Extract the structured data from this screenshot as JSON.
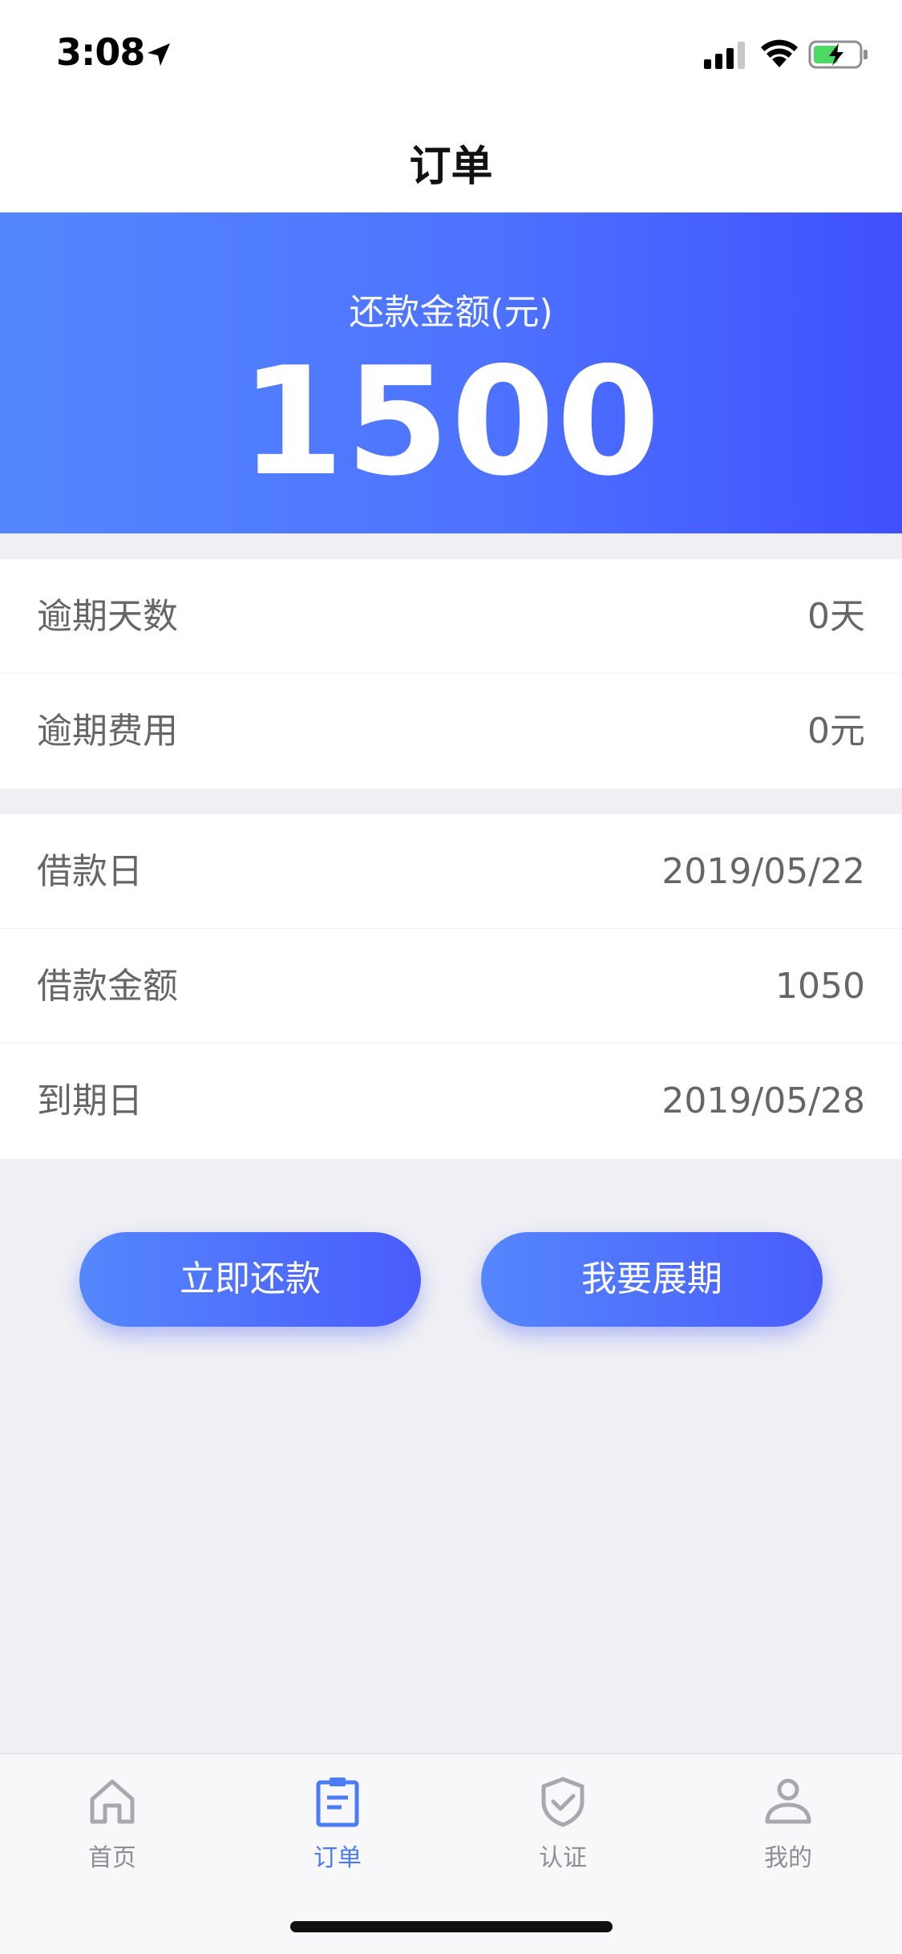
{
  "status_bar": {
    "time": "3:08"
  },
  "nav": {
    "title": "订单"
  },
  "hero": {
    "label": "还款金额(元)",
    "amount": "1500"
  },
  "overdue_section": [
    {
      "label": "逾期天数",
      "value": "0天"
    },
    {
      "label": "逾期费用",
      "value": "0元"
    }
  ],
  "loan_section": [
    {
      "label": "借款日",
      "value": "2019/05/22"
    },
    {
      "label": "借款金额",
      "value": "1050"
    },
    {
      "label": "到期日",
      "value": "2019/05/28"
    }
  ],
  "actions": {
    "repay_label": "立即还款",
    "extend_label": "我要展期"
  },
  "tabs": [
    {
      "label": "首页",
      "icon": "home-icon",
      "active": false
    },
    {
      "label": "订单",
      "icon": "order-icon",
      "active": true
    },
    {
      "label": "认证",
      "icon": "shield-check-icon",
      "active": false
    },
    {
      "label": "我的",
      "icon": "user-icon",
      "active": false
    }
  ],
  "colors": {
    "accent": "#4b7cf5",
    "gradient_start": "#5487fd",
    "gradient_end": "#4050fd",
    "background": "#efeff4"
  }
}
